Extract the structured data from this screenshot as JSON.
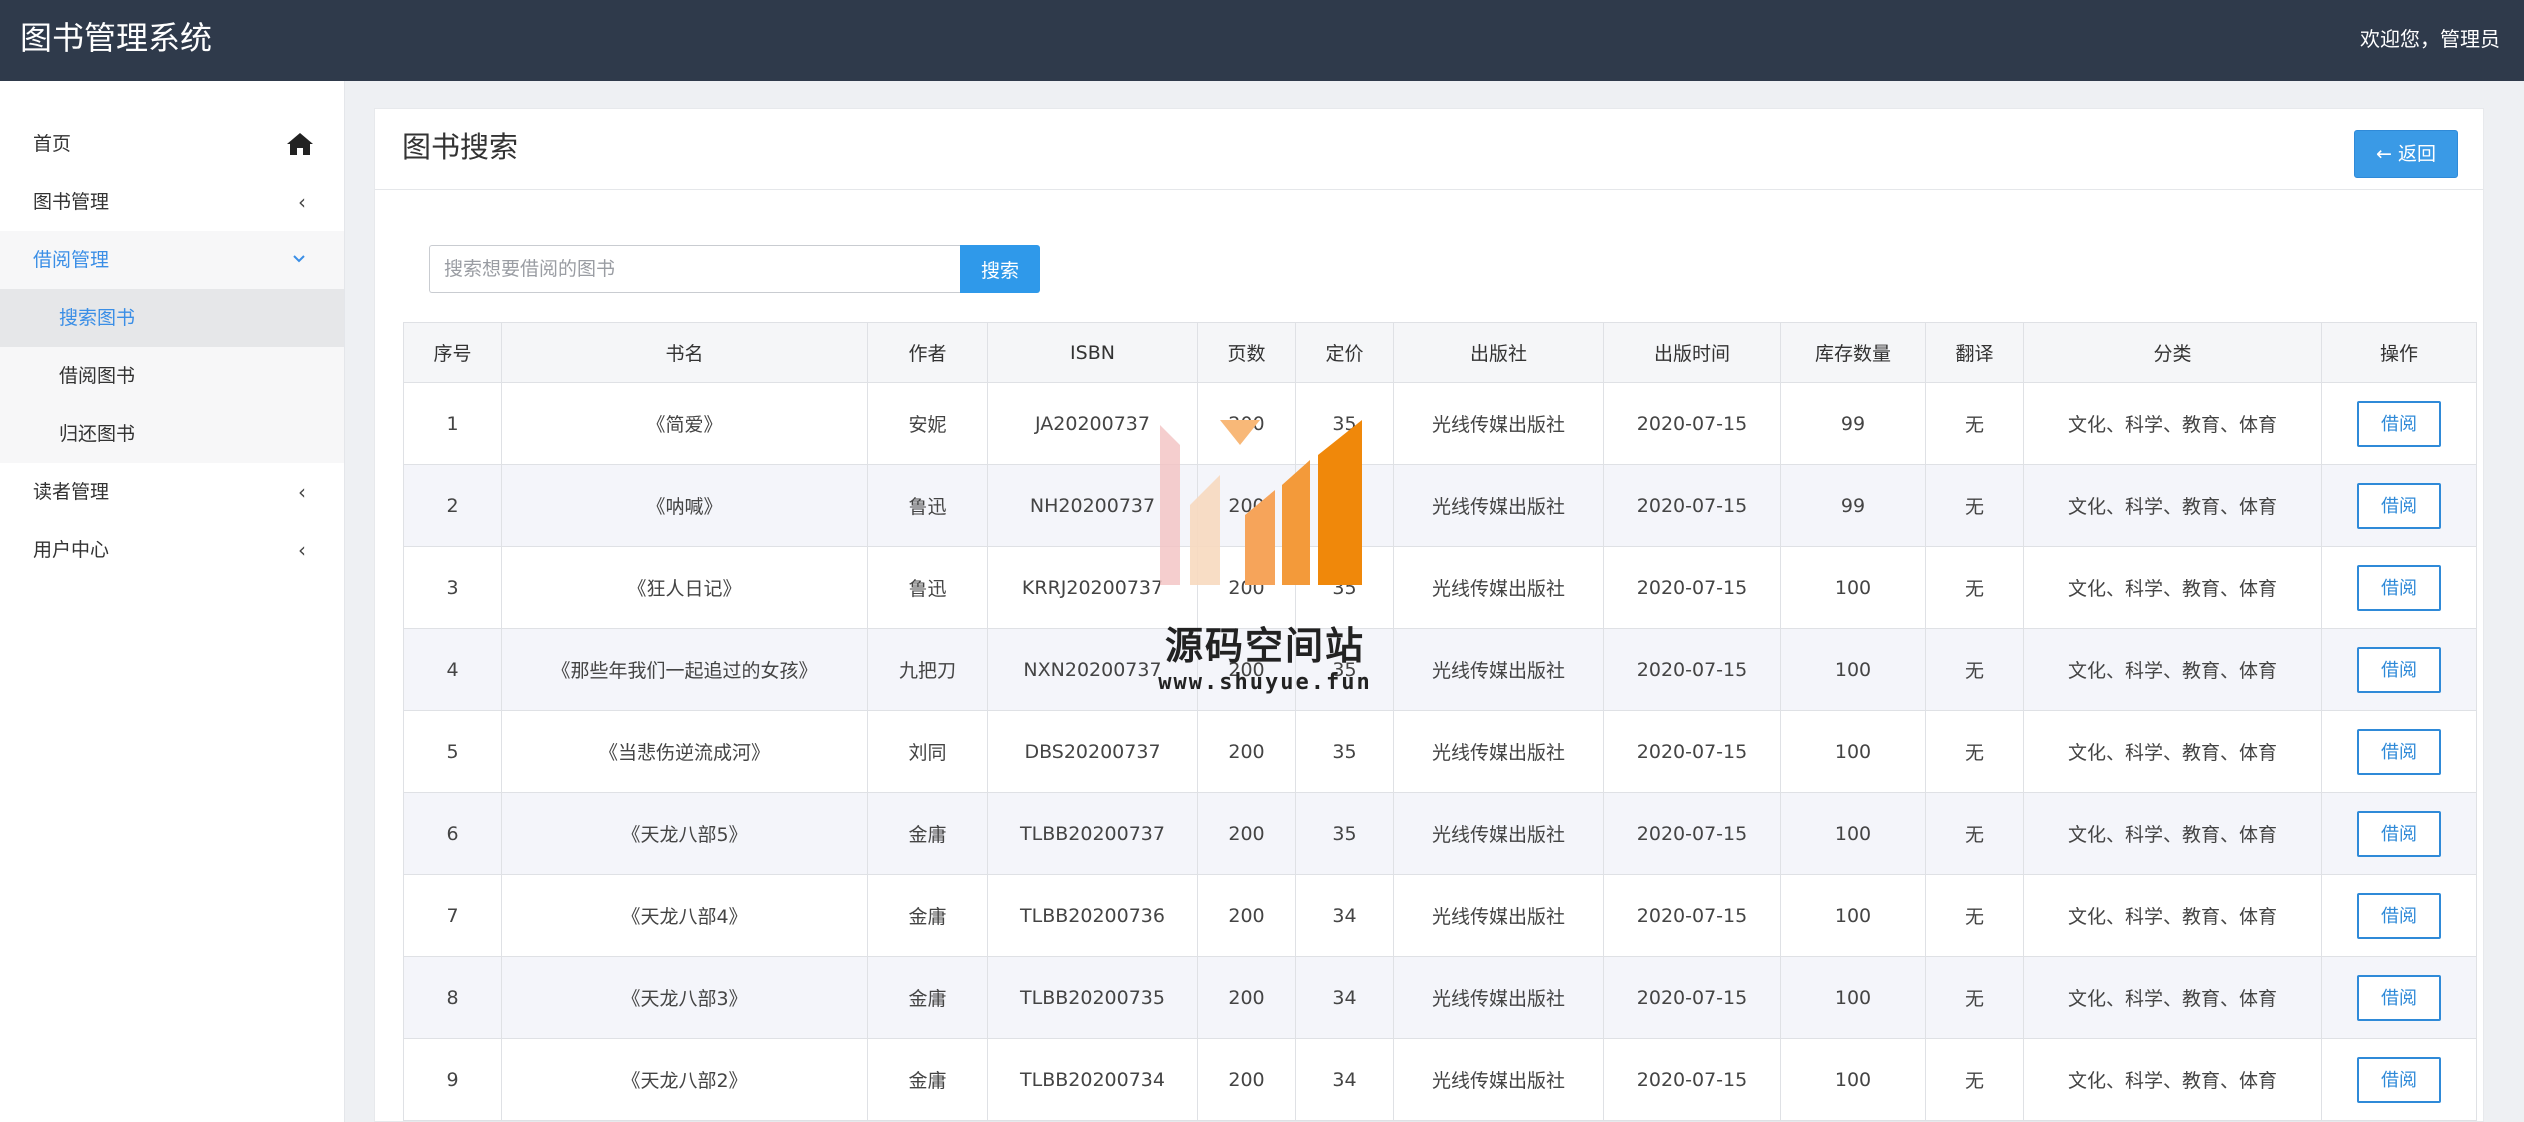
{
  "app": {
    "title": "图书管理系统",
    "welcome": "欢迎您，管理员"
  },
  "sidebar": {
    "items": [
      {
        "label": "首页",
        "icon": "home-icon"
      },
      {
        "label": "图书管理",
        "icon": "chevron-left-icon"
      },
      {
        "label": "借阅管理",
        "icon": "chevron-down-icon",
        "expanded": true,
        "children": [
          {
            "label": "搜索图书",
            "active": true
          },
          {
            "label": "借阅图书"
          },
          {
            "label": "归还图书"
          }
        ]
      },
      {
        "label": "读者管理",
        "icon": "chevron-left-icon"
      },
      {
        "label": "用户中心",
        "icon": "chevron-left-icon"
      }
    ]
  },
  "page": {
    "title": "图书搜索",
    "back_label": "返回"
  },
  "search": {
    "placeholder": "搜索想要借阅的图书",
    "value": "",
    "button_label": "搜索"
  },
  "table": {
    "columns": [
      "序号",
      "书名",
      "作者",
      "ISBN",
      "页数",
      "定价",
      "出版社",
      "出版时间",
      "库存数量",
      "翻译",
      "分类",
      "操作"
    ],
    "action_label": "借阅",
    "rows": [
      [
        "1",
        "《简爱》",
        "安妮",
        "JA20200737",
        "200",
        "35",
        "光线传媒出版社",
        "2020-07-15",
        "99",
        "无",
        "文化、科学、教育、体育"
      ],
      [
        "2",
        "《呐喊》",
        "鲁迅",
        "NH20200737",
        "200",
        "35",
        "光线传媒出版社",
        "2020-07-15",
        "99",
        "无",
        "文化、科学、教育、体育"
      ],
      [
        "3",
        "《狂人日记》",
        "鲁迅",
        "KRRJ20200737",
        "200",
        "35",
        "光线传媒出版社",
        "2020-07-15",
        "100",
        "无",
        "文化、科学、教育、体育"
      ],
      [
        "4",
        "《那些年我们一起追过的女孩》",
        "九把刀",
        "NXN20200737",
        "200",
        "35",
        "光线传媒出版社",
        "2020-07-15",
        "100",
        "无",
        "文化、科学、教育、体育"
      ],
      [
        "5",
        "《当悲伤逆流成河》",
        "刘同",
        "DBS20200737",
        "200",
        "35",
        "光线传媒出版社",
        "2020-07-15",
        "100",
        "无",
        "文化、科学、教育、体育"
      ],
      [
        "6",
        "《天龙八部5》",
        "金庸",
        "TLBB20200737",
        "200",
        "35",
        "光线传媒出版社",
        "2020-07-15",
        "100",
        "无",
        "文化、科学、教育、体育"
      ],
      [
        "7",
        "《天龙八部4》",
        "金庸",
        "TLBB20200736",
        "200",
        "34",
        "光线传媒出版社",
        "2020-07-15",
        "100",
        "无",
        "文化、科学、教育、体育"
      ],
      [
        "8",
        "《天龙八部3》",
        "金庸",
        "TLBB20200735",
        "200",
        "34",
        "光线传媒出版社",
        "2020-07-15",
        "100",
        "无",
        "文化、科学、教育、体育"
      ],
      [
        "9",
        "《天龙八部2》",
        "金庸",
        "TLBB20200734",
        "200",
        "34",
        "光线传媒出版社",
        "2020-07-15",
        "100",
        "无",
        "文化、科学、教育、体育"
      ]
    ]
  },
  "watermark": {
    "title": "源码空间站",
    "url": "www.shuyue.fun"
  },
  "colors": {
    "topbar": "#2f3a4b",
    "accent": "#3a8ee6",
    "button": "#2f99ea"
  }
}
